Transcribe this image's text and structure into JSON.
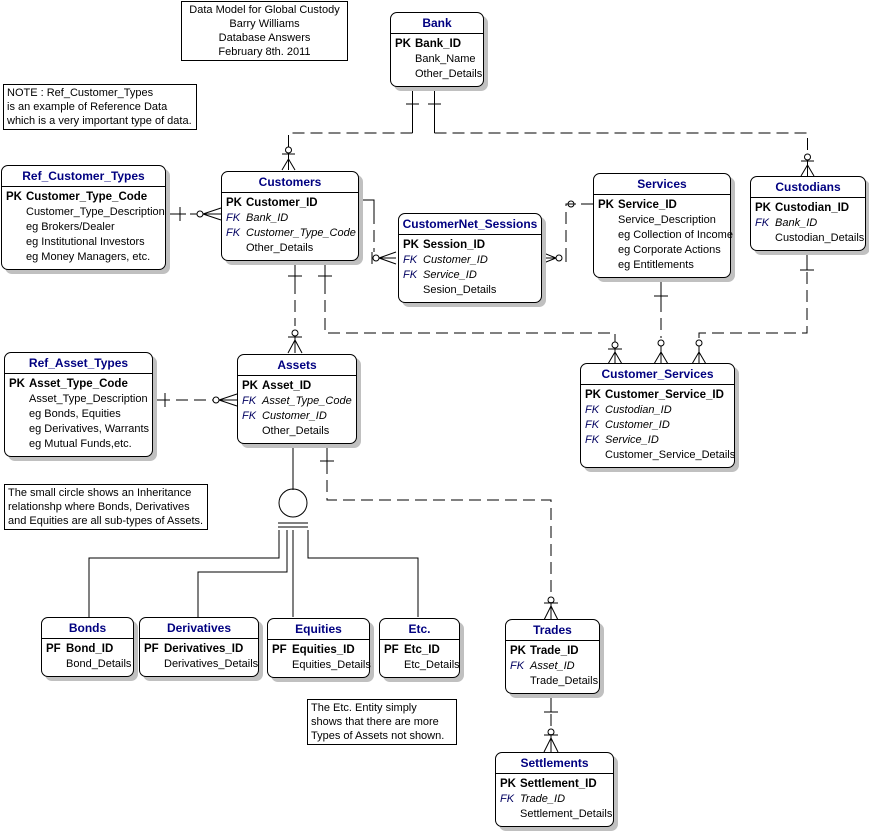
{
  "title_note": {
    "lines": [
      "Data Model for Global Custody",
      "Barry Williams",
      "Database Answers",
      "February 8th. 2011"
    ]
  },
  "notes": {
    "ref_data": [
      "NOTE : Ref_Customer_Types",
      "is an example of Reference Data",
      "which is a very important type of data."
    ],
    "inheritance": [
      "The small circle shows an Inheritance",
      "relationshp where Bonds, Derivatives",
      "and Equities are all sub-types of Assets."
    ],
    "etc": [
      "The Etc. Entity simply",
      "shows that there are more",
      "Types of Assets not shown."
    ]
  },
  "entities": {
    "bank": {
      "title": "Bank",
      "rows": [
        {
          "key": "PK",
          "name": "Bank_ID",
          "kind": "pk"
        },
        {
          "key": "",
          "name": "Bank_Name",
          "kind": "attr"
        },
        {
          "key": "",
          "name": "Other_Details",
          "kind": "attr"
        }
      ]
    },
    "ref_customer_types": {
      "title": "Ref_Customer_Types",
      "rows": [
        {
          "key": "PK",
          "name": "Customer_Type_Code",
          "kind": "pk"
        },
        {
          "key": "",
          "name": "Customer_Type_Description",
          "kind": "attr"
        },
        {
          "key": "",
          "name": "eg Brokers/Dealer",
          "kind": "attr"
        },
        {
          "key": "",
          "name": "eg Institutional Investors",
          "kind": "attr"
        },
        {
          "key": "",
          "name": "eg Money Managers, etc.",
          "kind": "attr"
        }
      ]
    },
    "customers": {
      "title": "Customers",
      "rows": [
        {
          "key": "PK",
          "name": "Customer_ID",
          "kind": "pk"
        },
        {
          "key": "FK",
          "name": "Bank_ID",
          "kind": "fk"
        },
        {
          "key": "FK",
          "name": "Customer_Type_Code",
          "kind": "fk"
        },
        {
          "key": "",
          "name": "Other_Details",
          "kind": "attr"
        }
      ]
    },
    "customernet_sessions": {
      "title": "CustomerNet_Sessions",
      "rows": [
        {
          "key": "PK",
          "name": "Session_ID",
          "kind": "pk"
        },
        {
          "key": "FK",
          "name": "Customer_ID",
          "kind": "fk"
        },
        {
          "key": "FK",
          "name": "Service_ID",
          "kind": "fk"
        },
        {
          "key": "",
          "name": "Sesion_Details",
          "kind": "attr"
        }
      ]
    },
    "services": {
      "title": "Services",
      "rows": [
        {
          "key": "PK",
          "name": "Service_ID",
          "kind": "pk"
        },
        {
          "key": "",
          "name": "Service_Description",
          "kind": "attr"
        },
        {
          "key": "",
          "name": "eg Collection of Income",
          "kind": "attr"
        },
        {
          "key": "",
          "name": "eg Corporate Actions",
          "kind": "attr"
        },
        {
          "key": "",
          "name": "eg Entitlements",
          "kind": "attr"
        }
      ]
    },
    "custodians": {
      "title": "Custodians",
      "rows": [
        {
          "key": "PK",
          "name": "Custodian_ID",
          "kind": "pk"
        },
        {
          "key": "FK",
          "name": "Bank_ID",
          "kind": "fk"
        },
        {
          "key": "",
          "name": "Custodian_Details",
          "kind": "attr"
        }
      ]
    },
    "customer_services": {
      "title": "Customer_Services",
      "rows": [
        {
          "key": "PK",
          "name": "Customer_Service_ID",
          "kind": "pk"
        },
        {
          "key": "FK",
          "name": "Custodian_ID",
          "kind": "fk"
        },
        {
          "key": "FK",
          "name": "Customer_ID",
          "kind": "fk"
        },
        {
          "key": "FK",
          "name": "Service_ID",
          "kind": "fk"
        },
        {
          "key": "",
          "name": "Customer_Service_Details",
          "kind": "attr"
        }
      ]
    },
    "ref_asset_types": {
      "title": "Ref_Asset_Types",
      "rows": [
        {
          "key": "PK",
          "name": "Asset_Type_Code",
          "kind": "pk"
        },
        {
          "key": "",
          "name": "Asset_Type_Description",
          "kind": "attr"
        },
        {
          "key": "",
          "name": "eg Bonds, Equities",
          "kind": "attr"
        },
        {
          "key": "",
          "name": "eg Derivatives, Warrants",
          "kind": "attr"
        },
        {
          "key": "",
          "name": "eg Mutual Funds,etc.",
          "kind": "attr"
        }
      ]
    },
    "assets": {
      "title": "Assets",
      "rows": [
        {
          "key": "PK",
          "name": "Asset_ID",
          "kind": "pk"
        },
        {
          "key": "FK",
          "name": "Asset_Type_Code",
          "kind": "fk"
        },
        {
          "key": "FK",
          "name": "Customer_ID",
          "kind": "fk"
        },
        {
          "key": "",
          "name": "Other_Details",
          "kind": "attr"
        }
      ]
    },
    "bonds": {
      "title": "Bonds",
      "rows": [
        {
          "key": "PF",
          "name": "Bond_ID",
          "kind": "pk"
        },
        {
          "key": "",
          "name": "Bond_Details",
          "kind": "attr"
        }
      ]
    },
    "derivatives": {
      "title": "Derivatives",
      "rows": [
        {
          "key": "PF",
          "name": "Derivatives_ID",
          "kind": "pk"
        },
        {
          "key": "",
          "name": "Derivatives_Details",
          "kind": "attr"
        }
      ]
    },
    "equities": {
      "title": "Equities",
      "rows": [
        {
          "key": "PF",
          "name": "Equities_ID",
          "kind": "pk"
        },
        {
          "key": "",
          "name": "Equities_Details",
          "kind": "attr"
        }
      ]
    },
    "etc": {
      "title": "Etc.",
      "rows": [
        {
          "key": "PF",
          "name": "Etc_ID",
          "kind": "pk"
        },
        {
          "key": "",
          "name": "Etc_Details",
          "kind": "attr"
        }
      ]
    },
    "trades": {
      "title": "Trades",
      "rows": [
        {
          "key": "PK",
          "name": "Trade_ID",
          "kind": "pk"
        },
        {
          "key": "FK",
          "name": "Asset_ID",
          "kind": "fk"
        },
        {
          "key": "",
          "name": "Trade_Details",
          "kind": "attr"
        }
      ]
    },
    "settlements": {
      "title": "Settlements",
      "rows": [
        {
          "key": "PK",
          "name": "Settlement_ID",
          "kind": "pk"
        },
        {
          "key": "FK",
          "name": "Trade_ID",
          "kind": "fk"
        },
        {
          "key": "",
          "name": "Settlement_Details",
          "kind": "attr"
        }
      ]
    }
  },
  "relationships": [
    {
      "from": "bank",
      "to": "customers",
      "type": "one-to-zero-or-many",
      "style": "dashed"
    },
    {
      "from": "bank",
      "to": "custodians",
      "type": "one-to-zero-or-many",
      "style": "dashed"
    },
    {
      "from": "ref_customer_types",
      "to": "customers",
      "type": "one-to-zero-or-many",
      "style": "dashed"
    },
    {
      "from": "customers",
      "to": "customernet_sessions",
      "type": "one-to-zero-or-many",
      "style": "dashed"
    },
    {
      "from": "services",
      "to": "customernet_sessions",
      "type": "one-to-zero-or-many",
      "style": "dashed"
    },
    {
      "from": "customers",
      "to": "assets",
      "type": "one-to-zero-or-many",
      "style": "dashed"
    },
    {
      "from": "customers",
      "to": "customer_services",
      "type": "one-to-zero-or-many",
      "style": "dashed"
    },
    {
      "from": "services",
      "to": "customer_services",
      "type": "one-to-zero-or-many",
      "style": "dashed"
    },
    {
      "from": "custodians",
      "to": "customer_services",
      "type": "one-to-zero-or-many",
      "style": "dashed"
    },
    {
      "from": "ref_asset_types",
      "to": "assets",
      "type": "one-to-zero-or-many",
      "style": "dashed"
    },
    {
      "from": "assets",
      "to": "trades",
      "type": "one-to-zero-or-many",
      "style": "dashed"
    },
    {
      "from": "trades",
      "to": "settlements",
      "type": "one-to-zero-or-many",
      "style": "dashed"
    },
    {
      "from": "assets",
      "to": [
        "bonds",
        "derivatives",
        "equities",
        "etc"
      ],
      "type": "inheritance",
      "style": "solid"
    }
  ]
}
